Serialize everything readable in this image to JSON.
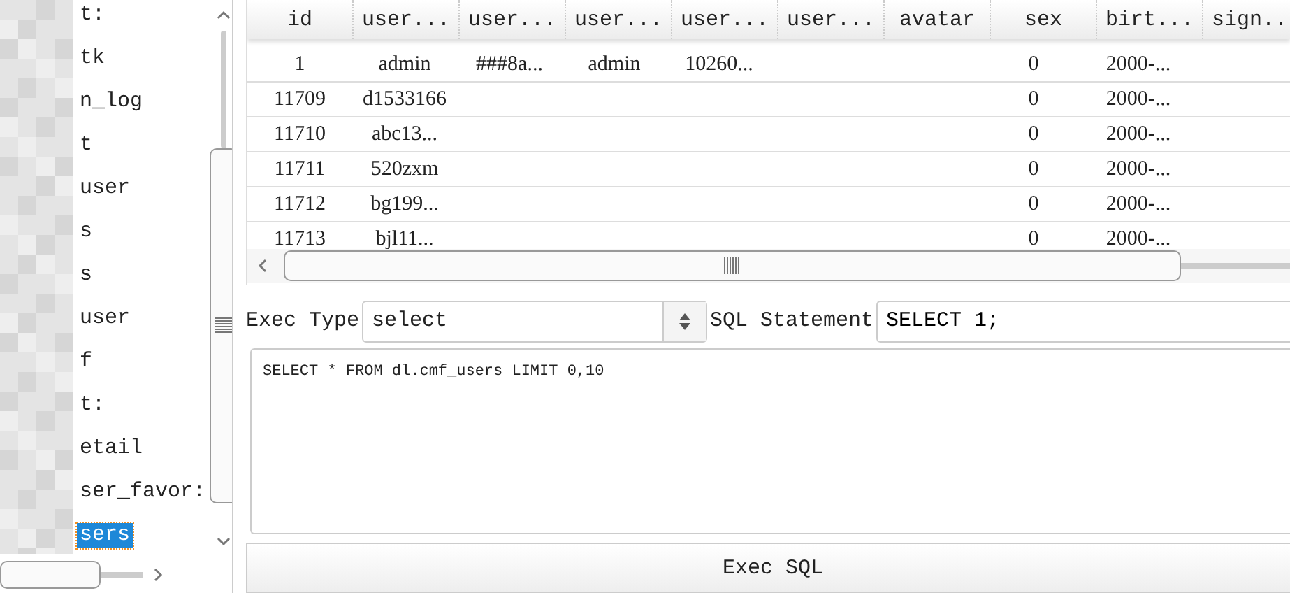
{
  "tree": {
    "items": [
      {
        "label": "t:",
        "selected": false
      },
      {
        "label": "tk",
        "selected": false
      },
      {
        "label": "n_log",
        "selected": false
      },
      {
        "label": "t",
        "selected": false
      },
      {
        "label": "user",
        "selected": false
      },
      {
        "label": "s",
        "selected": false
      },
      {
        "label": "s",
        "selected": false
      },
      {
        "label": "user",
        "selected": false
      },
      {
        "label": "f",
        "selected": false
      },
      {
        "label": "t:",
        "selected": false
      },
      {
        "label": "etail",
        "selected": false
      },
      {
        "label": "ser_favor:",
        "selected": false
      },
      {
        "label": "sers",
        "selected": true
      }
    ]
  },
  "table": {
    "columns": [
      "id",
      "user...",
      "user...",
      "user...",
      "user...",
      "user...",
      "avatar",
      "sex",
      "birt...",
      "sign..."
    ],
    "rows": [
      [
        "1",
        "admin",
        "###8a...",
        "admin",
        "10260...",
        null,
        null,
        "0",
        "2000-...",
        null
      ],
      [
        "11709",
        "d1533166",
        null,
        null,
        null,
        null,
        null,
        "0",
        "2000-...",
        null
      ],
      [
        "11710",
        "abc13...",
        null,
        null,
        null,
        null,
        null,
        "0",
        "2000-...",
        null
      ],
      [
        "11711",
        "520zxm",
        null,
        null,
        null,
        null,
        null,
        "0",
        "2000-...",
        null
      ],
      [
        "11712",
        "bg199...",
        null,
        null,
        null,
        null,
        null,
        "0",
        "2000-...",
        null
      ],
      [
        "11713",
        "bjl11...",
        null,
        null,
        null,
        null,
        null,
        "0",
        "2000-...",
        null
      ]
    ]
  },
  "exec_type": {
    "label": "Exec Type",
    "value": "select"
  },
  "sql_statement": {
    "label": "SQL Statement",
    "value": "SELECT 1;"
  },
  "query": {
    "value": "SELECT * FROM dl.cmf_users LIMIT 0,10"
  },
  "exec_button": "Exec SQL"
}
